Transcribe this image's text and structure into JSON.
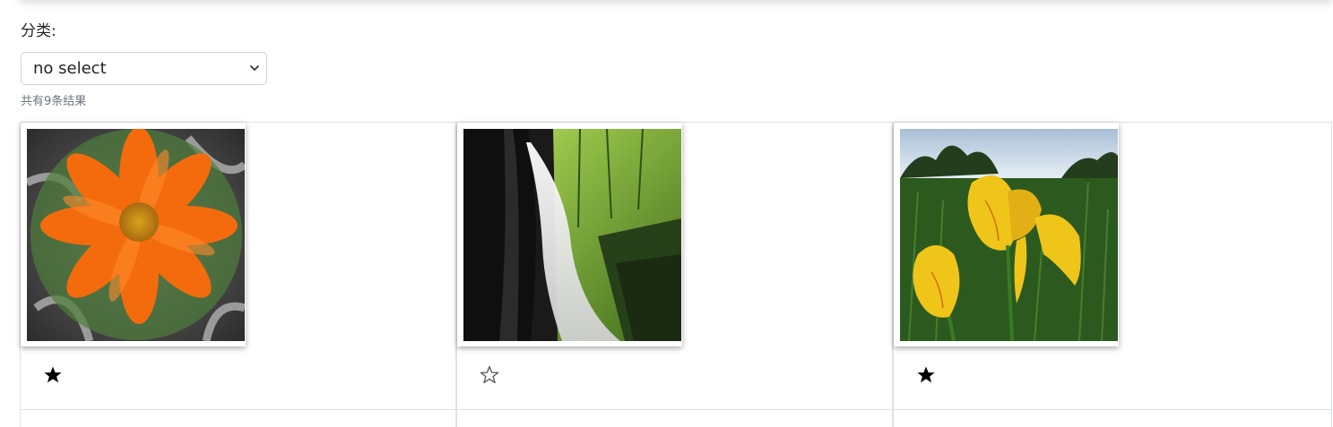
{
  "filter": {
    "label": "分类:",
    "selected": "no select",
    "result_count": "共有9条结果"
  },
  "gallery": {
    "items": [
      {
        "subject": "orange cosmos flower",
        "favorited": true,
        "icon": "star-filled-icon"
      },
      {
        "subject": "waterfall in forest",
        "favorited": false,
        "icon": "star-outline-icon"
      },
      {
        "subject": "yellow iris flowers",
        "favorited": true,
        "icon": "star-filled-icon"
      }
    ]
  },
  "colors": {
    "border": "#dee2e6",
    "muted_text": "#6c757d",
    "star": "#000000"
  }
}
